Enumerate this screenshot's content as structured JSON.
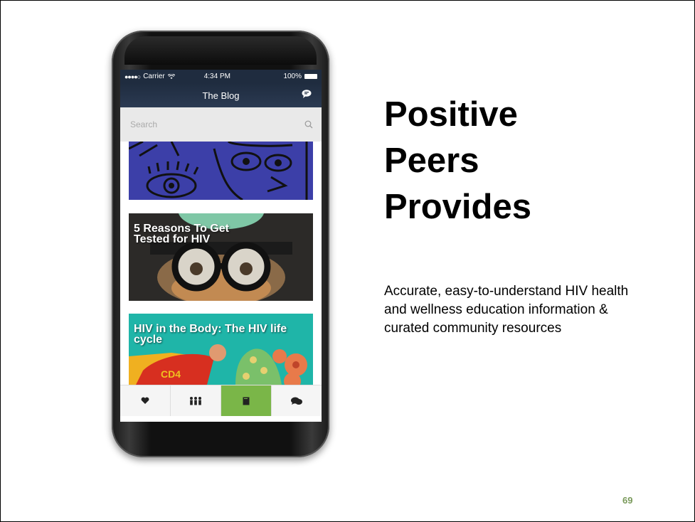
{
  "phone": {
    "status": {
      "carrier": "Carrier",
      "time": "4:34 PM",
      "battery": "100%"
    },
    "nav_title": "The Blog",
    "search_placeholder": "Search",
    "posts": [
      {
        "title": ""
      },
      {
        "title": "5 Reasons To Get Tested for HIV"
      },
      {
        "title": "HIV in the Body: The HIV life cycle"
      }
    ],
    "tabs": [
      {
        "icon": "heart-icon"
      },
      {
        "icon": "people-icon"
      },
      {
        "icon": "book-icon",
        "active": true
      },
      {
        "icon": "chat-icon"
      }
    ]
  },
  "heading": {
    "line1": "Positive",
    "line2": "Peers",
    "line3": "Provides"
  },
  "description": "Accurate, easy-to-understand HIV health and wellness education information & curated community resources",
  "page_number": "69",
  "colors": {
    "active_tab": "#7ab648",
    "navbar": "#1f2c3f",
    "page_number": "#7a9a5b"
  }
}
